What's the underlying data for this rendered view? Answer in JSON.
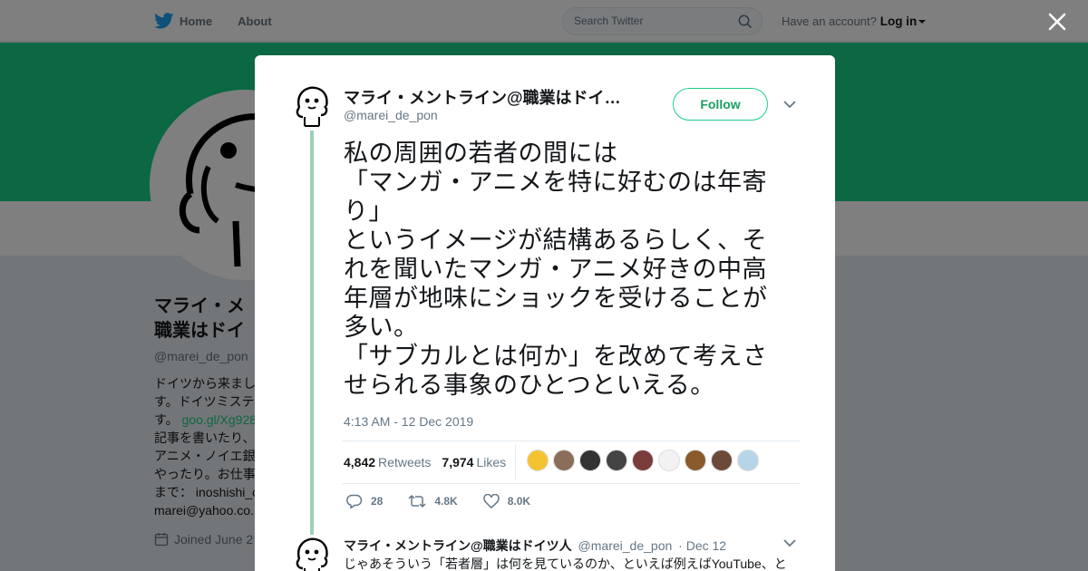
{
  "topbar": {
    "home_label": "Home",
    "about_label": "About",
    "search_placeholder": "Search Twitter",
    "account_prompt": "Have an account?",
    "login_label": "Log in"
  },
  "colors": {
    "accent": "#19cf86",
    "follow_text": "#19a063",
    "thread_line": "#9ad1b8",
    "twitter_blue": "#1da1f2"
  },
  "profile": {
    "name_line1": "マライ・メ",
    "name_line2": "職業はドイ",
    "handle": "@marei_de_pon",
    "bio_lines": [
      "ドイツから来まし",
      "す。ドイツミステ",
      "す。",
      "記事を書いたり、",
      "アニメ・ノイエ銀",
      "やったり。お仕事",
      "まで： inoshishi_c",
      "marei@yahoo.co."
    ],
    "bio_link": "goo.gl/Xg928",
    "joined": "Joined June 2"
  },
  "modal": {
    "author_name": "マライ・メントライン@職業はドイツ人",
    "author_handle": "@marei_de_pon",
    "follow_label": "Follow",
    "tweet_text": "私の周囲の若者の間には\n「マンガ・アニメを特に好むのは年寄り」\nというイメージが結構あるらしく、それを聞いたマンガ・アニメ好きの中高年層が地味にショックを受けることが多い。\n「サブカルとは何か」を改めて考えさせられる事象のひとつといえる。",
    "timestamp": "4:13 AM - 12 Dec 2019",
    "retweets_count": "4,842",
    "retweets_label": "Retweets",
    "likes_count": "7,974",
    "likes_label": "Likes",
    "likers": [
      "#f4c430",
      "#8a6d5a",
      "#333333",
      "#444444",
      "#7a3b3b",
      "#f2f2f2",
      "#8b5a2b",
      "#6b4a3a",
      "#b8d4e8"
    ],
    "actions": {
      "reply_count": "28",
      "retweet_count": "4.8K",
      "like_count": "8.0K"
    }
  },
  "reply": {
    "author_name": "マライ・メントライン@職業はドイツ人",
    "author_handle": "@marei_de_pon",
    "date": "· Dec 12",
    "text": "じゃあそういう「若者層」は何を見ているのか、といえば例えばYouTube、と"
  }
}
